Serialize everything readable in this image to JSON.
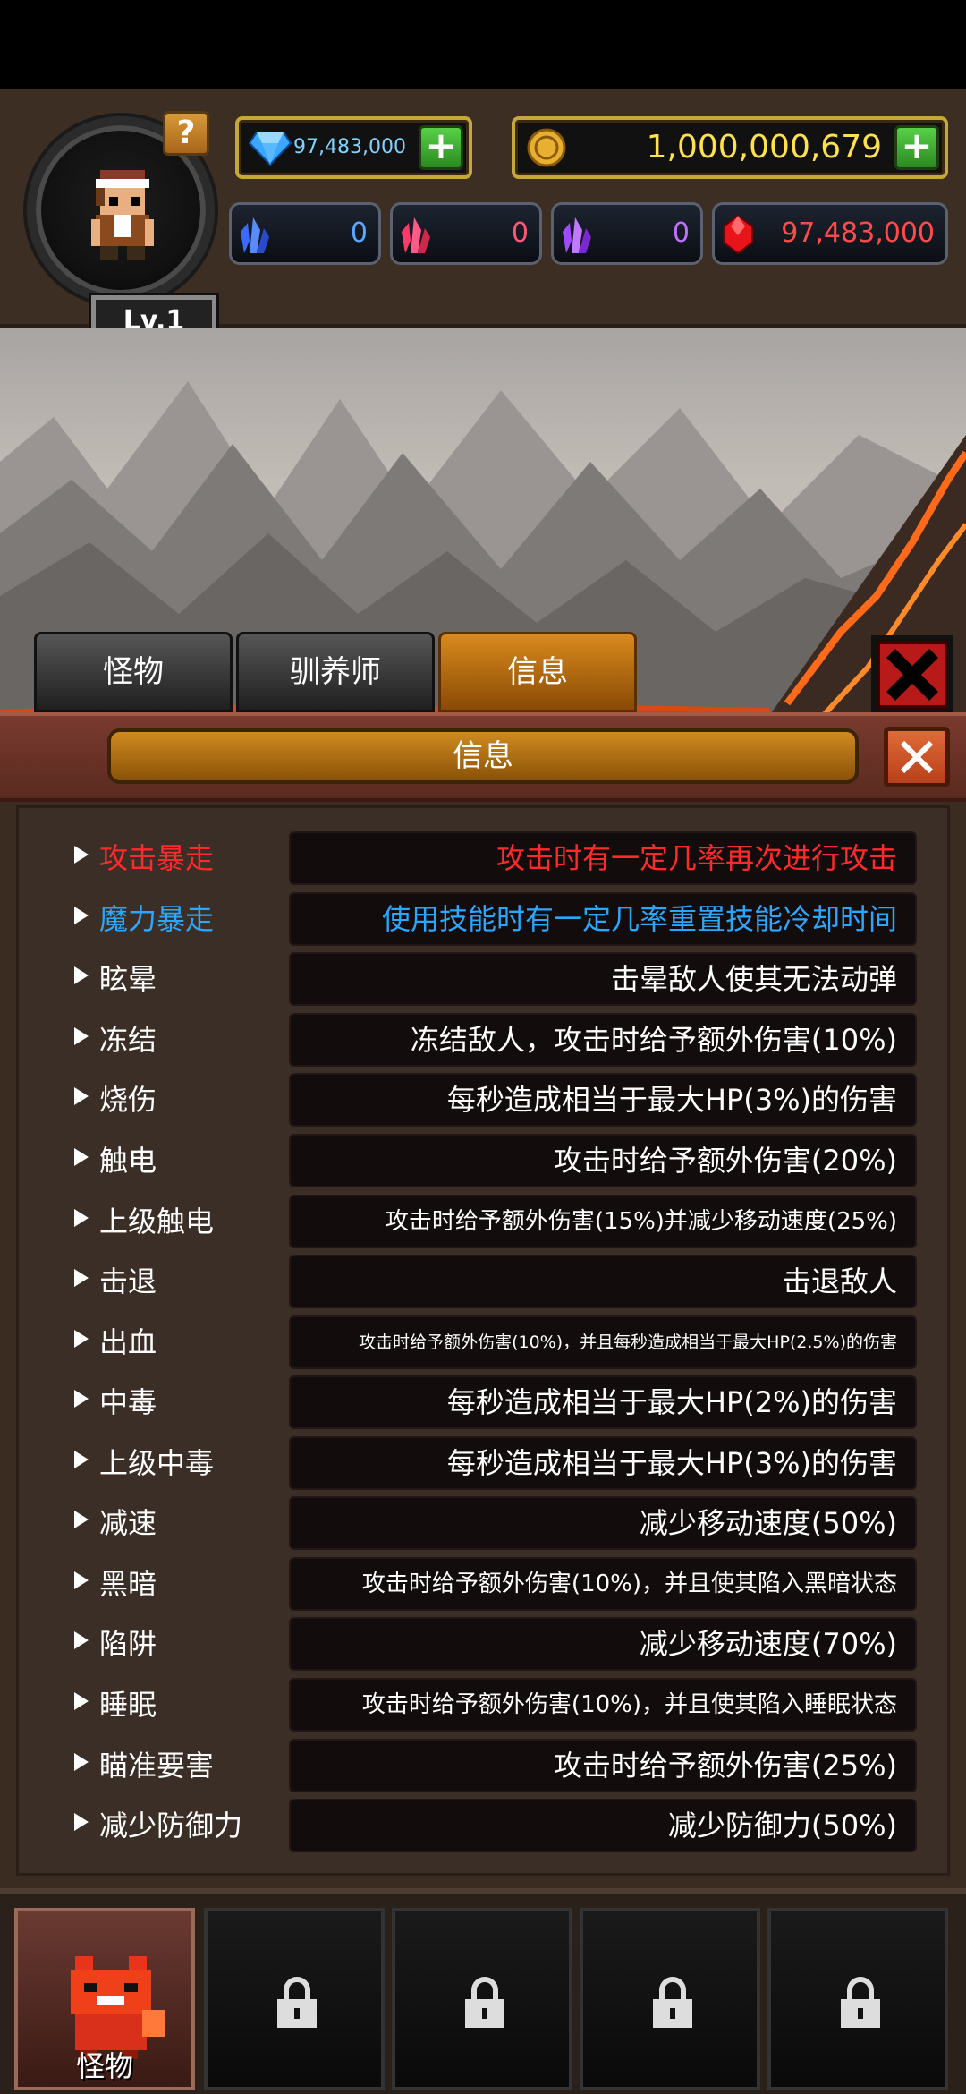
{
  "header": {
    "help_label": "?",
    "level": "Lv.1",
    "gems": "97,483,000",
    "gold": "1,000,000,679",
    "plus_label": "+",
    "crystals": {
      "blue": "0",
      "red": "0",
      "purple": "0",
      "ruby": "97,483,000"
    }
  },
  "tabs": [
    {
      "label": "怪物"
    },
    {
      "label": "驯养师"
    },
    {
      "label": "信息"
    }
  ],
  "panel": {
    "title": "信息"
  },
  "effects": [
    {
      "name": "攻击暴走",
      "desc": "攻击时有一定几率再次进行攻击",
      "color": "#ff2a2a"
    },
    {
      "name": "魔力暴走",
      "desc": "使用技能时有一定几率重置技能冷却时间",
      "color": "#2aa8ff"
    },
    {
      "name": "眩晕",
      "desc": "击晕敌人使其无法动弹"
    },
    {
      "name": "冻结",
      "desc": "冻结敌人，攻击时给予额外伤害(10%)"
    },
    {
      "name": "烧伤",
      "desc": "每秒造成相当于最大HP(3%)的伤害"
    },
    {
      "name": "触电",
      "desc": "攻击时给予额外伤害(20%)"
    },
    {
      "name": "上级触电",
      "desc": "攻击时给予额外伤害(15%)并减少移动速度(25%)"
    },
    {
      "name": "击退",
      "desc": "击退敌人"
    },
    {
      "name": "出血",
      "desc": "攻击时给予额外伤害(10%)，并且每秒造成相当于最大HP(2.5%)的伤害"
    },
    {
      "name": "中毒",
      "desc": "每秒造成相当于最大HP(2%)的伤害"
    },
    {
      "name": "上级中毒",
      "desc": "每秒造成相当于最大HP(3%)的伤害"
    },
    {
      "name": "减速",
      "desc": "减少移动速度(50%)"
    },
    {
      "name": "黑暗",
      "desc": "攻击时给予额外伤害(10%)，并且使其陷入黑暗状态"
    },
    {
      "name": "陷阱",
      "desc": "减少移动速度(70%)"
    },
    {
      "name": "睡眠",
      "desc": "攻击时给予额外伤害(10%)，并且使其陷入睡眠状态"
    },
    {
      "name": "瞄准要害",
      "desc": "攻击时给予额外伤害(25%)"
    },
    {
      "name": "减少防御力",
      "desc": "减少防御力(50%)"
    }
  ],
  "bottom_bar": {
    "active_slot_label": "怪物"
  }
}
